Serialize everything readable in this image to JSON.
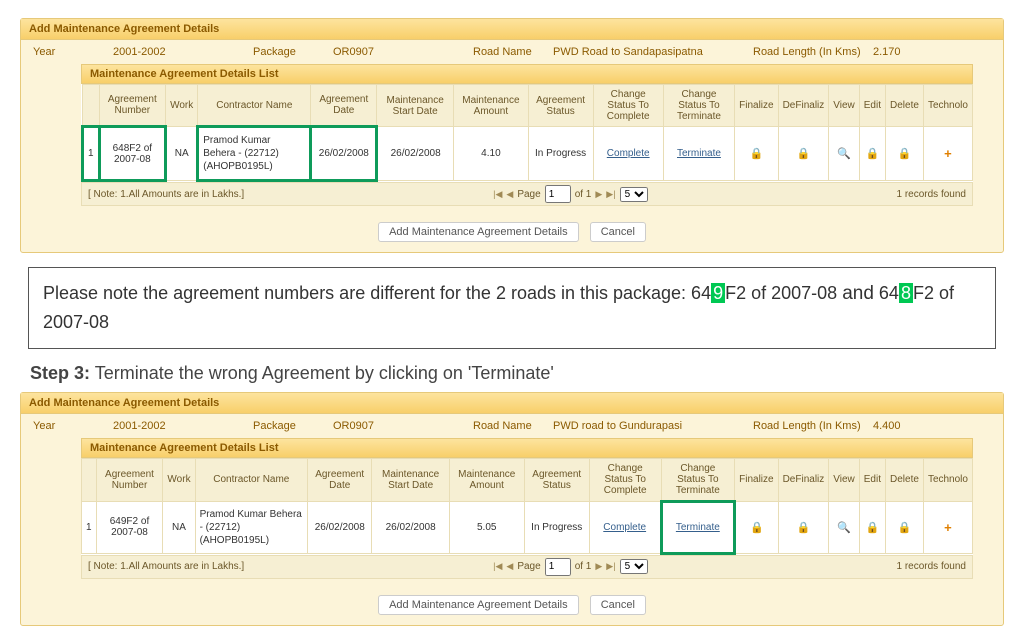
{
  "panel_title": "Add Maintenance Agreement Details",
  "labels": {
    "year": "Year",
    "package": "Package",
    "road": "Road Name",
    "len": "Road Length (In Kms)"
  },
  "year": "2001-2002",
  "package": "OR0907",
  "road1": "PWD Road to Sandapasipatna",
  "len1": "2.170",
  "road2": "PWD road to Gundurapasi",
  "len2": "4.400",
  "list_title": "Maintenance Agreement Details List",
  "cols": {
    "sn": "",
    "agr": "Agreement Number",
    "work": "Work",
    "contr": "Contractor Name",
    "adate": "Agreement Date",
    "sdate": "Maintenance Start Date",
    "amt": "Maintenance Amount",
    "status": "Agreement Status",
    "comp": "Change Status To Complete",
    "term": "Change Status To Terminate",
    "fin": "Finalize",
    "defin": "DeFinaliz",
    "view": "View",
    "edit": "Edit",
    "del": "Delete",
    "tech": "Technolo"
  },
  "rows": [
    {
      "sn": "1",
      "agr": "648F2 of 2007-08",
      "work": "NA",
      "contr": "Pramod Kumar Behera - (22712)(AHOPB0195L)",
      "adate": "26/02/2008",
      "sdate": "26/02/2008",
      "amt": "4.10",
      "status": "In Progress",
      "comp": "Complete",
      "term": "Terminate"
    },
    {
      "sn": "1",
      "agr": "649F2 of 2007-08",
      "work": "NA",
      "contr": "Pramod Kumar Behera - (22712)(AHOPB0195L)",
      "adate": "26/02/2008",
      "sdate": "26/02/2008",
      "amt": "5.05",
      "status": "In Progress",
      "comp": "Complete",
      "term": "Terminate"
    }
  ],
  "note": "[ Note: 1.All Amounts are in Lakhs.]",
  "pager": {
    "page_lbl": "Page",
    "of_lbl": "of 1",
    "page": "1",
    "size": "5"
  },
  "records": "1 records found",
  "btn_add": "Add Maintenance Agreement Details",
  "btn_cancel": "Cancel",
  "msg": {
    "a": "Please note the agreement numbers are different for the 2 roads in this package: 64",
    "b": "F2 of 2007-08 ",
    "and": "and",
    "c": " 64",
    "d": "F2 of 2007-08",
    "h1": "9",
    "h2": "8"
  },
  "step": {
    "lbl": "Step 3:",
    "txt": " Terminate the wrong Agreement by clicking on 'Terminate'"
  }
}
